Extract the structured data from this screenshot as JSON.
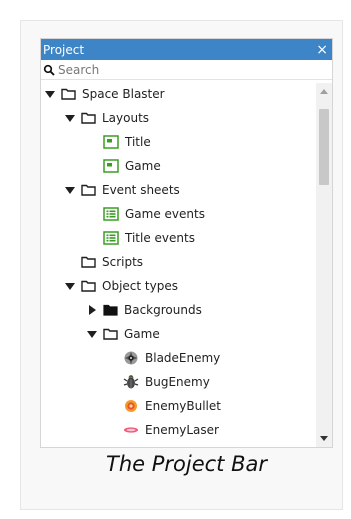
{
  "panel": {
    "title": "Project",
    "close_glyph": "×"
  },
  "search": {
    "placeholder": "Search",
    "value": ""
  },
  "tree": {
    "root": "Space Blaster",
    "layouts_folder": "Layouts",
    "layout_title": "Title",
    "layout_game": "Game",
    "event_sheets_folder": "Event sheets",
    "event_game": "Game events",
    "event_title": "Title events",
    "scripts_folder": "Scripts",
    "object_types_folder": "Object types",
    "backgrounds_folder": "Backgrounds",
    "game_folder": "Game",
    "obj_blade": "BladeEnemy",
    "obj_bug": "BugEnemy",
    "obj_bullet": "EnemyBullet",
    "obj_laser": "EnemyLaser"
  },
  "caption": "The Project Bar",
  "colors": {
    "titlebar": "#3d85c6",
    "layout_icon": "#3a9d23",
    "eventsheet_icon": "#3a9d23",
    "folder_outline": "#1f1f1f"
  },
  "icons": {
    "expanded": "triangle-down-icon",
    "collapsed": "triangle-right-icon",
    "folder": "folder-outline-icon",
    "folder_filled": "folder-filled-icon",
    "layout": "layout-icon",
    "event_sheet": "event-sheet-icon"
  }
}
